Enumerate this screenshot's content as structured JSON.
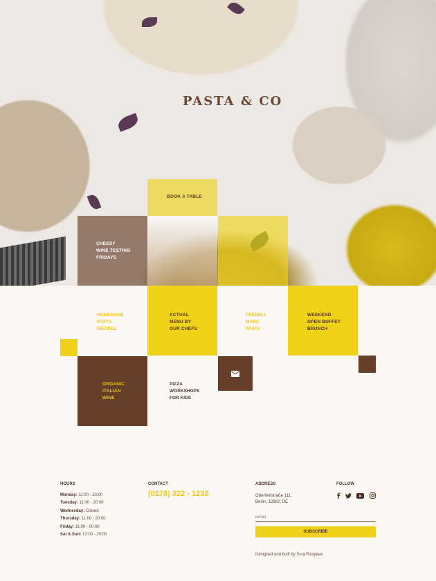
{
  "hero": {
    "logo": "PASTA & CO",
    "tiles": {
      "book_table": "BOOK A TABLE",
      "cheesy": [
        "CHEESY",
        "WINE TESTING",
        "FRIDAYS"
      ]
    }
  },
  "grid": {
    "homemade": [
      "HOMEMADE",
      "PASTA",
      "RECIPES"
    ],
    "actual_menu": [
      "ACTUAL",
      "MENU BY",
      "OUR CHEFS"
    ],
    "freshly": [
      "FRESHLY",
      "MADE",
      "PASTA"
    ],
    "weekend": [
      "WEEKEND",
      "OPEN BUFFET",
      "BRUNCH"
    ],
    "organic": [
      "ORGANIC",
      "ITALIAN",
      "WINE"
    ],
    "pizza": [
      "PIZZA",
      "WORKSHOPS",
      "FOR KIDS"
    ],
    "mail_icon": "envelope-icon"
  },
  "footer": {
    "hours": {
      "heading": "HOURS",
      "rows": [
        {
          "day": "Monday:",
          "time": "11:00 - 20:00"
        },
        {
          "day": "Tuesday:",
          "time": "11:00 - 20:00"
        },
        {
          "day": "Wednesday:",
          "time": "Closed"
        },
        {
          "day": "Thursday:",
          "time": "11:00 - 20:00"
        },
        {
          "day": "Friday:",
          "time": "11:00 - 00:00"
        },
        {
          "day": "Sat & Sun:",
          "time": "12:00 - 20:00"
        }
      ]
    },
    "contact": {
      "heading": "CONTACT",
      "phone": "(0178) 322 - 1232"
    },
    "address": {
      "heading": "ADDRESS",
      "line1": "Oberfeldstraße 111,",
      "line2": "Berlin, 12982, DE"
    },
    "follow": {
      "heading": "FOLLOW",
      "icons": [
        "facebook-icon",
        "twitter-icon",
        "youtube-icon",
        "instagram-icon"
      ]
    },
    "newsletter": {
      "placeholder": "Email",
      "button": "SUBSCRIBE"
    },
    "credit": "Designed and built by Sura Rzayeva"
  },
  "colors": {
    "yellow": "#f0d21a",
    "brown": "#653f29",
    "phone": "#f0c419",
    "background": "#fbf8f3"
  }
}
